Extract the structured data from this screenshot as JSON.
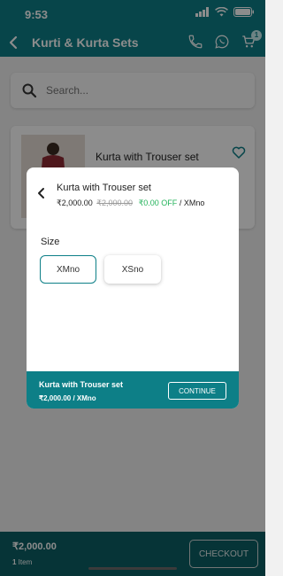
{
  "status_bar": {
    "time": "9:53"
  },
  "header": {
    "title": "Kurti & Kurta Sets",
    "cart_count": "1"
  },
  "search": {
    "placeholder": "Search..."
  },
  "product_card": {
    "name": "Kurta with Trouser set"
  },
  "modal": {
    "title": "Kurta with Trouser set",
    "price": "₹2,000.00",
    "mrp": "₹2,000.00",
    "off": "₹0.00 OFF",
    "size_suffix": " / XMno",
    "size_label": "Size",
    "sizes": [
      "XMno",
      "XSno"
    ],
    "selected_size": "XMno",
    "footer_name": "Kurta with Trouser set",
    "footer_price": "₹2,000.00 / XMno",
    "continue_label": "CONTINUE"
  },
  "bottom_bar": {
    "total": "₹2,000.00",
    "items_count": "1",
    "items_label": " Item",
    "checkout_label": "CHECKOUT"
  },
  "colors": {
    "primary": "#0d7f87",
    "bottom_bar": "#0b5f64",
    "off": "#23b35a"
  }
}
